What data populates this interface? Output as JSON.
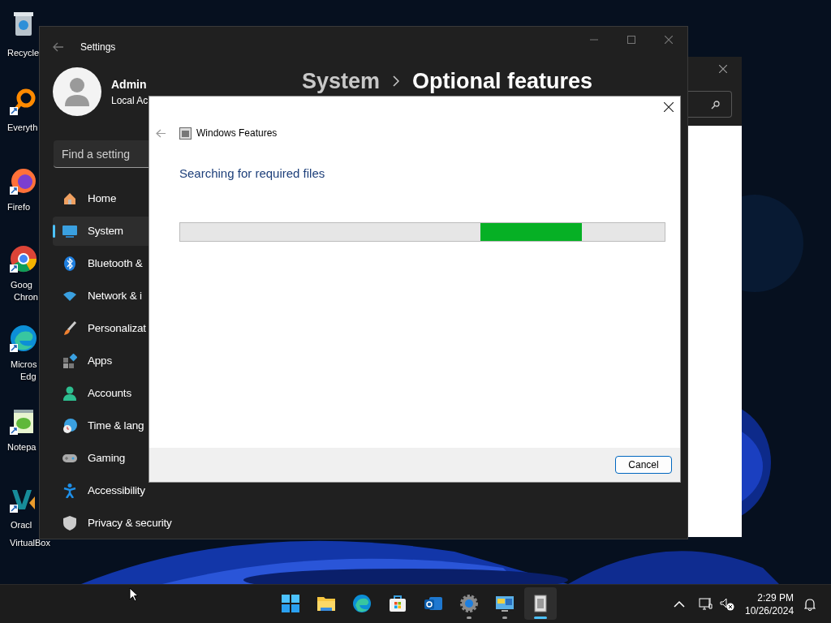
{
  "desktop": {
    "icons": [
      {
        "kind": "recycle",
        "lines": [
          "Recycle"
        ]
      },
      {
        "kind": "everything",
        "lines": [
          "Everyth"
        ]
      },
      {
        "kind": "firefox",
        "lines": [
          "Firefo"
        ]
      },
      {
        "kind": "chrome",
        "lines": [
          "Goog",
          "Chron"
        ]
      },
      {
        "kind": "edge",
        "lines": [
          "Micros",
          "Edg"
        ]
      },
      {
        "kind": "notepad",
        "lines": [
          "Notepa"
        ]
      },
      {
        "kind": "virtualbox",
        "lines": [
          "Oracl",
          "VirtualBox"
        ]
      }
    ]
  },
  "settings": {
    "title": "Settings",
    "user": {
      "name": "Admin",
      "account": "Local Ac"
    },
    "search": {
      "placeholder": "Find a setting"
    },
    "breadcrumb": [
      "System",
      "Optional features"
    ],
    "nav": [
      {
        "kind": "home",
        "label": "Home",
        "selected": false
      },
      {
        "kind": "system",
        "label": "System",
        "selected": true
      },
      {
        "kind": "bluetooth",
        "label": "Bluetooth &",
        "selected": false
      },
      {
        "kind": "network",
        "label": "Network & i",
        "selected": false
      },
      {
        "kind": "personalization",
        "label": "Personalizat",
        "selected": false
      },
      {
        "kind": "apps",
        "label": "Apps",
        "selected": false
      },
      {
        "kind": "accounts",
        "label": "Accounts",
        "selected": false
      },
      {
        "kind": "time",
        "label": "Time & lang",
        "selected": false
      },
      {
        "kind": "gaming",
        "label": "Gaming",
        "selected": false
      },
      {
        "kind": "accessibility",
        "label": "Accessibility",
        "selected": false
      },
      {
        "kind": "privacy",
        "label": "Privacy & security",
        "selected": false
      }
    ]
  },
  "dialog": {
    "title": "Windows Features",
    "heading": "Searching for required files",
    "progress": {
      "marquee": true
    },
    "buttons": [
      "Cancel"
    ]
  },
  "taskbar": {
    "apps": [
      {
        "kind": "start",
        "running": false,
        "active": false
      },
      {
        "kind": "explorer",
        "running": false,
        "active": false
      },
      {
        "kind": "edge",
        "running": false,
        "active": false
      },
      {
        "kind": "store",
        "running": false,
        "active": false
      },
      {
        "kind": "outlook",
        "running": false,
        "active": false
      },
      {
        "kind": "settings",
        "running": true,
        "active": false
      },
      {
        "kind": "control",
        "running": true,
        "active": false
      },
      {
        "kind": "features",
        "running": true,
        "active": true
      }
    ],
    "tray": {
      "time": "2:29 PM",
      "date": "10/26/2024"
    }
  }
}
